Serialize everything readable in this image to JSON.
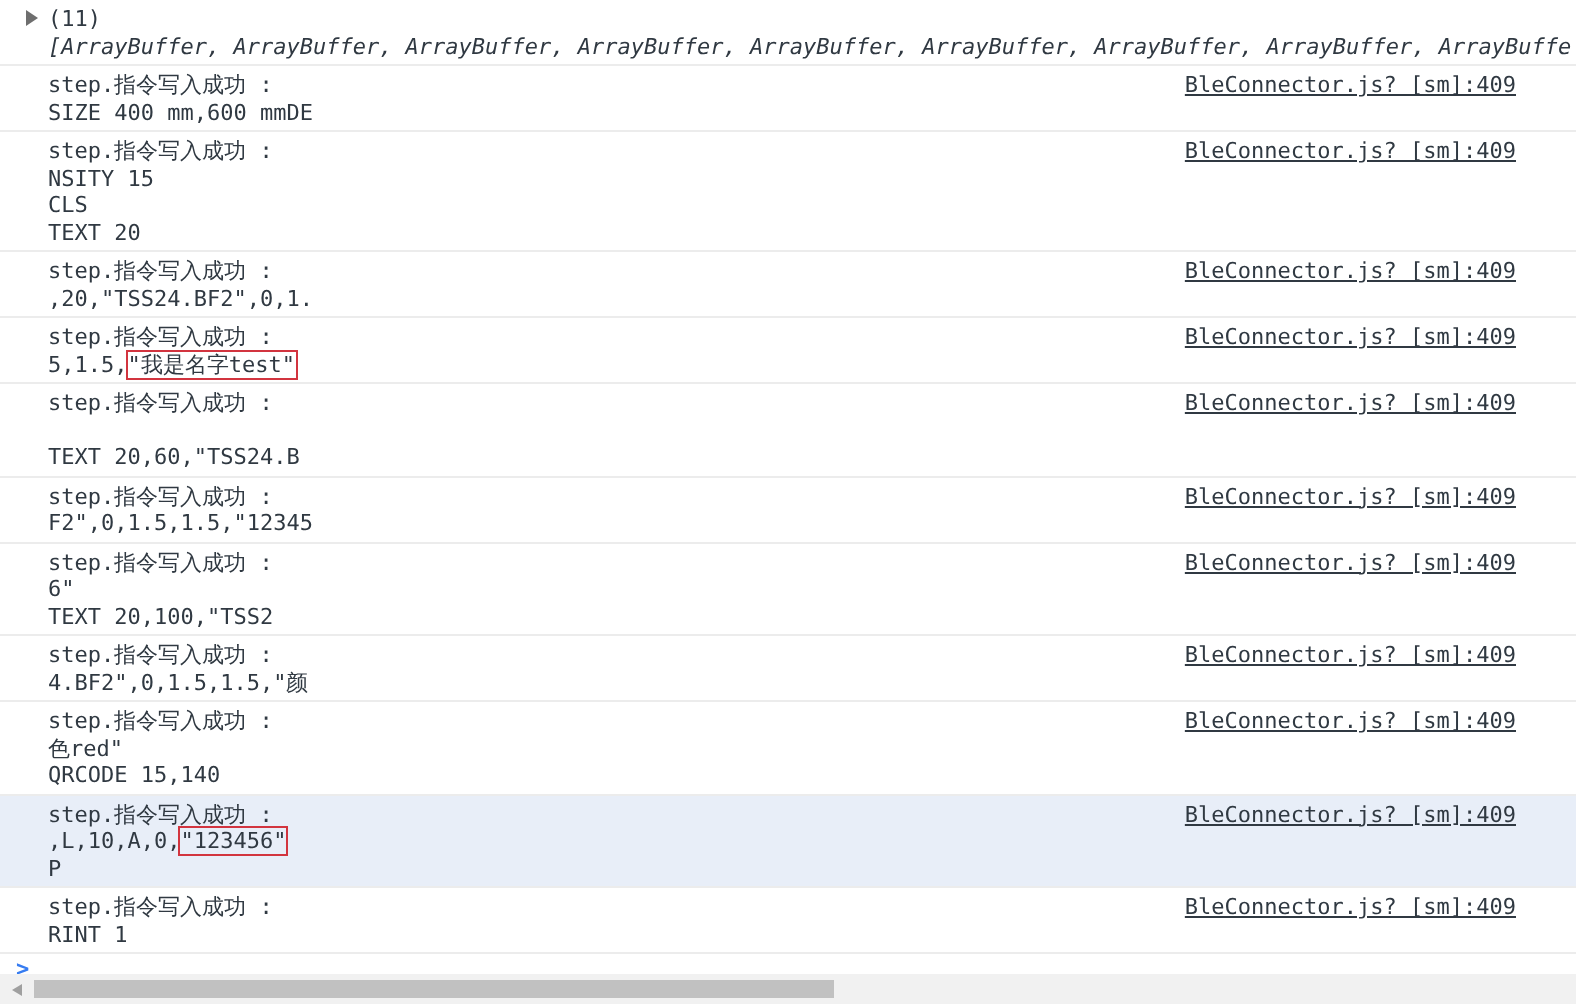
{
  "array_entry": {
    "count": "(11)",
    "expanded": false,
    "preview": "[ArrayBuffer, ArrayBuffer, ArrayBuffer, ArrayBuffer, ArrayBuffer, ArrayBuffer, ArrayBuffer, ArrayBuffer, ArrayBuffe"
  },
  "messages": [
    {
      "header": "step.指令写入成功 :",
      "source": "BleConnector.js? [sm]:409",
      "selected": false,
      "blank_line": false,
      "lines": [
        [
          {
            "text": "SIZE 400 mm,600 mmDE",
            "boxed": false
          }
        ]
      ]
    },
    {
      "header": "step.指令写入成功 :",
      "source": "BleConnector.js? [sm]:409",
      "selected": false,
      "blank_line": false,
      "lines": [
        [
          {
            "text": "NSITY 15",
            "boxed": false
          }
        ],
        [
          {
            "text": "CLS",
            "boxed": false
          }
        ],
        [
          {
            "text": "TEXT 20",
            "boxed": false
          }
        ]
      ]
    },
    {
      "header": "step.指令写入成功 :",
      "source": "BleConnector.js? [sm]:409",
      "selected": false,
      "blank_line": false,
      "lines": [
        [
          {
            "text": ",20,\"TSS24.BF2\",0,1.",
            "boxed": false
          }
        ]
      ]
    },
    {
      "header": "step.指令写入成功 :",
      "source": "BleConnector.js? [sm]:409",
      "selected": false,
      "blank_line": false,
      "lines": [
        [
          {
            "text": "5,1.5,",
            "boxed": false
          },
          {
            "text": "\"我是名字test\"",
            "boxed": true
          }
        ]
      ]
    },
    {
      "header": "step.指令写入成功 :",
      "source": "BleConnector.js? [sm]:409",
      "selected": false,
      "blank_line": true,
      "lines": [
        [
          {
            "text": "TEXT 20,60,\"TSS24.B",
            "boxed": false
          }
        ]
      ]
    },
    {
      "header": "step.指令写入成功 :",
      "source": "BleConnector.js? [sm]:409",
      "selected": false,
      "blank_line": false,
      "lines": [
        [
          {
            "text": "F2\",0,1.5,1.5,\"12345",
            "boxed": false
          }
        ]
      ]
    },
    {
      "header": "step.指令写入成功 :",
      "source": "BleConnector.js? [sm]:409",
      "selected": false,
      "blank_line": false,
      "lines": [
        [
          {
            "text": "6\"",
            "boxed": false
          }
        ],
        [
          {
            "text": "TEXT 20,100,\"TSS2",
            "boxed": false
          }
        ]
      ]
    },
    {
      "header": "step.指令写入成功 :",
      "source": "BleConnector.js? [sm]:409",
      "selected": false,
      "blank_line": false,
      "lines": [
        [
          {
            "text": "4.BF2\",0,1.5,1.5,\"颜",
            "boxed": false
          }
        ]
      ]
    },
    {
      "header": "step.指令写入成功 :",
      "source": "BleConnector.js? [sm]:409",
      "selected": false,
      "blank_line": false,
      "lines": [
        [
          {
            "text": "色red\"",
            "boxed": false
          }
        ],
        [
          {
            "text": "QRCODE 15,140",
            "boxed": false
          }
        ]
      ]
    },
    {
      "header": "step.指令写入成功 :",
      "source": "BleConnector.js? [sm]:409",
      "selected": true,
      "blank_line": false,
      "lines": [
        [
          {
            "text": ",L,10,A,0,",
            "boxed": false
          },
          {
            "text": "\"123456\"",
            "boxed": true
          }
        ],
        [
          {
            "text": "P",
            "boxed": false
          }
        ]
      ]
    },
    {
      "header": "step.指令写入成功 :",
      "source": "BleConnector.js? [sm]:409",
      "selected": false,
      "blank_line": false,
      "lines": [
        [
          {
            "text": "RINT 1",
            "boxed": false
          }
        ]
      ]
    }
  ],
  "prompt": {
    "symbol": ">"
  }
}
